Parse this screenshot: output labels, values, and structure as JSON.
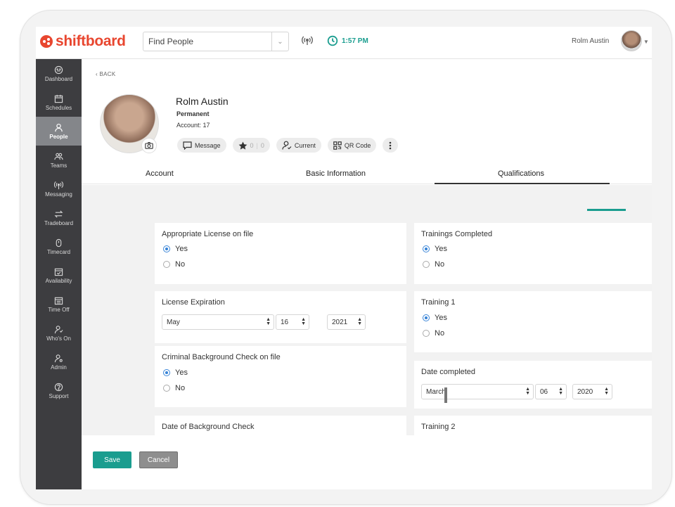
{
  "brand": {
    "name": "shiftboard",
    "color": "#e8462f"
  },
  "topbar": {
    "find_label": "Find People",
    "time": "1:57 PM",
    "username": "Rolm Austin",
    "accent": "#1a9d8f"
  },
  "sidebar": {
    "items": [
      {
        "label": "Dashboard",
        "icon": "dashboard-icon"
      },
      {
        "label": "Schedules",
        "icon": "calendar-icon"
      },
      {
        "label": "People",
        "icon": "person-icon",
        "active": true
      },
      {
        "label": "Teams",
        "icon": "teams-icon"
      },
      {
        "label": "Messaging",
        "icon": "broadcast-icon"
      },
      {
        "label": "Tradeboard",
        "icon": "swap-icon"
      },
      {
        "label": "Timecard",
        "icon": "timecard-icon"
      },
      {
        "label": "Availability",
        "icon": "availability-icon"
      },
      {
        "label": "Time Off",
        "icon": "timeoff-icon"
      },
      {
        "label": "Who's On",
        "icon": "whos-on-icon"
      },
      {
        "label": "Admin",
        "icon": "admin-icon"
      },
      {
        "label": "Support",
        "icon": "help-icon"
      }
    ]
  },
  "profile": {
    "back": "BACK",
    "name": "Rolm Austin",
    "type": "Permanent",
    "account": "Account: 17",
    "actions": {
      "message": "Message",
      "star_left": "0",
      "star_right": "0",
      "current": "Current",
      "qr": "QR Code"
    }
  },
  "tabs": [
    "Account",
    "Basic Information",
    "Qualifications"
  ],
  "qualifications": {
    "appropriate_license": {
      "title": "Appropriate License on file",
      "yes": "Yes",
      "no": "No",
      "selected": "Yes"
    },
    "trainings_completed": {
      "title": "Trainings Completed",
      "yes": "Yes",
      "no": "No",
      "selected": "Yes"
    },
    "license_expiration": {
      "title": "License Expiration",
      "month": "May",
      "day": "16",
      "year": "2021"
    },
    "training_1": {
      "title": "Training 1",
      "yes": "Yes",
      "no": "No",
      "selected": "Yes"
    },
    "criminal_background": {
      "title": "Criminal Background Check on file",
      "yes": "Yes",
      "no": "No",
      "selected": "Yes"
    },
    "date_completed": {
      "title": "Date completed",
      "month": "March",
      "day": "06",
      "year": "2020"
    },
    "date_background": {
      "title": "Date of Background Check"
    },
    "training_2": {
      "title": "Training 2"
    }
  },
  "footer": {
    "save": "Save",
    "cancel": "Cancel"
  }
}
